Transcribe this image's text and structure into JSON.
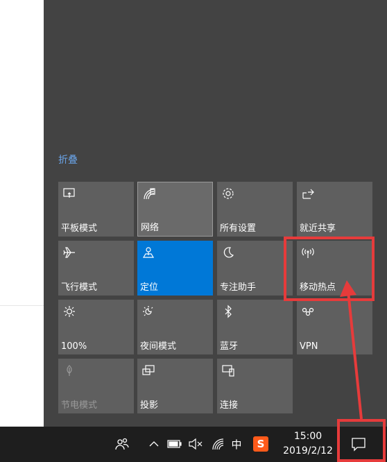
{
  "action_center": {
    "collapse_label": "折叠",
    "tiles": [
      {
        "label": "平板模式",
        "icon": "tablet-mode-icon",
        "state": "off"
      },
      {
        "label": "网络",
        "icon": "network-icon",
        "state": "hover"
      },
      {
        "label": "所有设置",
        "icon": "settings-gear-icon",
        "state": "off"
      },
      {
        "label": "就近共享",
        "icon": "nearby-share-icon",
        "state": "off"
      },
      {
        "label": "飞行模式",
        "icon": "airplane-icon",
        "state": "off"
      },
      {
        "label": "定位",
        "icon": "location-icon",
        "state": "on"
      },
      {
        "label": "专注助手",
        "icon": "moon-icon",
        "state": "off"
      },
      {
        "label": "移动热点",
        "icon": "hotspot-icon",
        "state": "off"
      },
      {
        "label": "100%",
        "icon": "brightness-icon",
        "state": "off"
      },
      {
        "label": "夜间模式",
        "icon": "night-light-icon",
        "state": "off"
      },
      {
        "label": "蓝牙",
        "icon": "bluetooth-icon",
        "state": "off"
      },
      {
        "label": "VPN",
        "icon": "vpn-icon",
        "state": "off"
      },
      {
        "label": "节电模式",
        "icon": "battery-saver-icon",
        "state": "disabled"
      },
      {
        "label": "投影",
        "icon": "project-icon",
        "state": "off"
      },
      {
        "label": "连接",
        "icon": "connect-icon",
        "state": "off"
      }
    ]
  },
  "taskbar": {
    "tray_icons": [
      "people-icon",
      "chevron-up-icon",
      "battery-icon",
      "volume-muted-icon",
      "wifi-icon"
    ],
    "ime_label": "中",
    "sogou_label": "S",
    "time": "15:00",
    "date": "2019/2/12",
    "notification_icon": "action-center-icon"
  },
  "colors": {
    "panel_bg": "#434343",
    "tile_bg": "#5f5f5f",
    "active_tile": "#0078d7",
    "link": "#6aa4e8",
    "taskbar_bg": "#1e1e1e",
    "annotation_red": "#e63b3b"
  }
}
